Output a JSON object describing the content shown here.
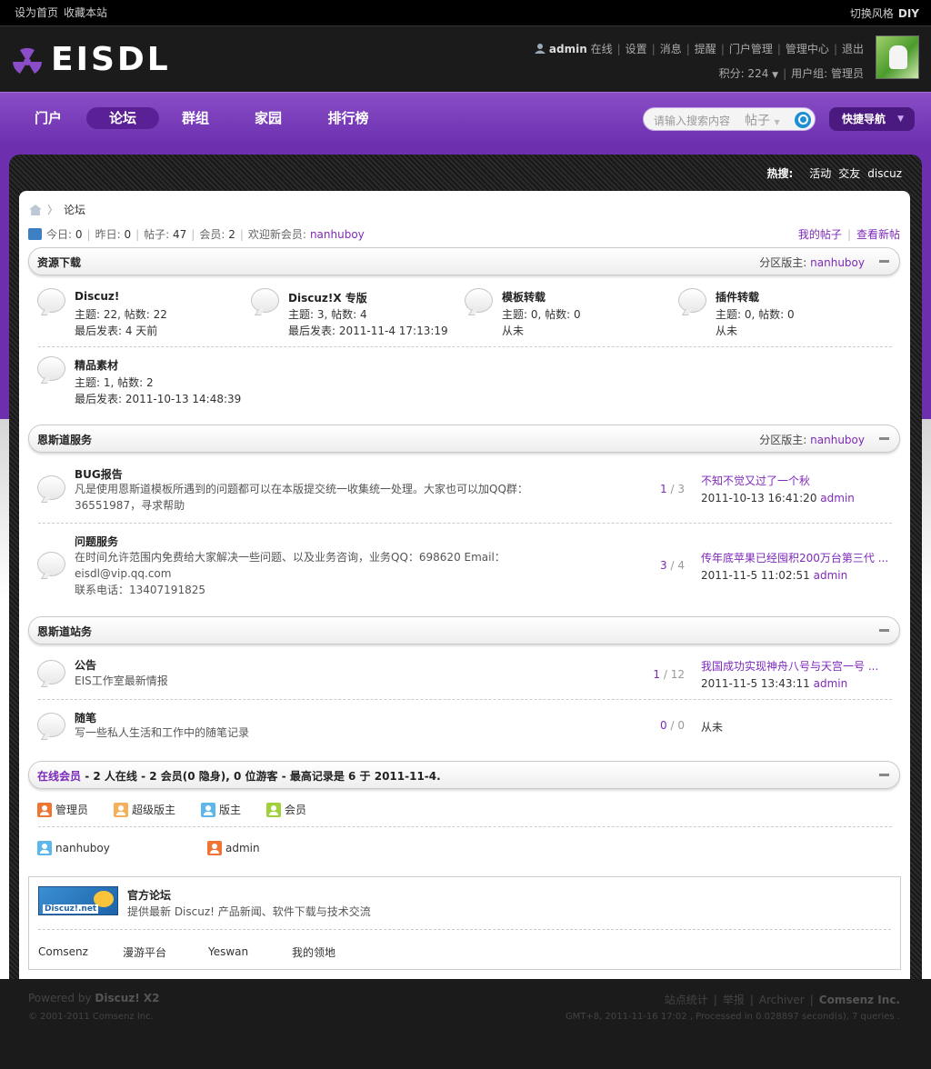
{
  "topbar": {
    "set_home": "设为首页",
    "bookmark": "收藏本站",
    "switch_style": "切换风格",
    "diy": "DIY"
  },
  "header": {
    "logo_text": "EISDL",
    "username": "admin",
    "online": "在线",
    "links": [
      "设置",
      "消息",
      "提醒",
      "门户管理",
      "管理中心",
      "退出"
    ],
    "credits": "积分: 224",
    "usergroup": "用户组: 管理员"
  },
  "nav": {
    "items": [
      "门户",
      "论坛",
      "群组",
      "家园",
      "排行榜"
    ],
    "active": "论坛",
    "search_placeholder": "请输入搜索内容",
    "search_type": "帖子",
    "quick_nav": "快捷导航"
  },
  "hot": {
    "label": "热搜:",
    "items": [
      "活动",
      "交友",
      "discuz"
    ]
  },
  "breadcrumb": {
    "current": "论坛"
  },
  "stats": {
    "today_label": "今日:",
    "today": "0",
    "yesterday_label": "昨日:",
    "yesterday": "0",
    "posts_label": "帖子:",
    "posts": "47",
    "members_label": "会员:",
    "members": "2",
    "welcome": "欢迎新会员:",
    "new_member": "nanhuboy"
  },
  "mylinks": {
    "my_posts": "我的帖子",
    "new_posts": "查看新帖"
  },
  "categories": [
    {
      "title": "资源下载",
      "mod_label": "分区版主:",
      "mod": "nanhuboy",
      "forums": [
        {
          "name": "Discuz!",
          "stats": "主题: 22, 帖数: 22",
          "last": "最后发表: 4 天前"
        },
        {
          "name": "Discuz!X 专版",
          "stats": "主题: 3, 帖数: 4",
          "last": "最后发表: 2011-11-4 17:13:19"
        },
        {
          "name": "模板转载",
          "stats": "主题: 0, 帖数: 0",
          "last": "从未"
        },
        {
          "name": "插件转载",
          "stats": "主题: 0, 帖数: 0",
          "last": "从未"
        },
        {
          "name": "精品素材",
          "stats": "主题: 1, 帖数: 2",
          "last": "最后发表: 2011-10-13 14:48:39"
        }
      ]
    },
    {
      "title": "恩斯道服务",
      "mod_label": "分区版主:",
      "mod": "nanhuboy",
      "forums": [
        {
          "name": "BUG报告",
          "desc": "凡是使用恩斯道模板所遇到的问题都可以在本版提交统一收集统一处理。大家也可以加QQ群：36551987，寻求帮助",
          "threads": "1",
          "posts": "3",
          "last_title": "不知不觉又过了一个秋",
          "last_date": "2011-10-13 16:41:20",
          "last_by": "admin"
        },
        {
          "name": "问题服务",
          "desc": "在时间允许范围内免费给大家解决一些问题、以及业务咨询，业务QQ：698620 Email：eisdl@vip.qq.com",
          "desc2": "联系电话：13407191825",
          "threads": "3",
          "posts": "4",
          "last_title": "传年底苹果已经囤积200万台第三代 ...",
          "last_date": "2011-11-5 11:02:51",
          "last_by": "admin"
        }
      ]
    },
    {
      "title": "恩斯道站务",
      "forums": [
        {
          "name": "公告",
          "desc": "EIS工作室最新情报",
          "threads": "1",
          "posts": "12",
          "last_title": "我国成功实现神舟八号与天宫一号 ...",
          "last_date": "2011-11-5 13:43:11",
          "last_by": "admin"
        },
        {
          "name": "随笔",
          "desc": "写一些私人生活和工作中的随笔记录",
          "threads": "0",
          "posts": "0",
          "last_never": "从未"
        }
      ]
    }
  ],
  "online": {
    "label": "在线会员",
    "summary": "- 2 人在线 - 2 会员(0 隐身), 0 位游客 - 最高记录是 6 于 2011-11-4.",
    "legend": [
      "管理员",
      "超级版主",
      "版主",
      "会员"
    ],
    "users": [
      "nanhuboy",
      "admin"
    ]
  },
  "links_box": {
    "logo_text": "Discuz!.net",
    "title": "官方论坛",
    "desc": "提供最新 Discuz! 产品新闻、软件下载与技术交流",
    "text_links": [
      "Comsenz",
      "漫游平台",
      "Yeswan",
      "我的领地"
    ]
  },
  "footer": {
    "powered": "Powered by",
    "product": "Discuz! X2",
    "copyright": "© 2001-2011",
    "company": "Comsenz Inc.",
    "links": [
      "站点统计",
      "举报",
      "Archiver"
    ],
    "company_bold": "Comsenz Inc.",
    "gmt": "GMT+8, 2011-11-16 17:02 , Processed in 0.028897 second(s), 7 queries ."
  }
}
